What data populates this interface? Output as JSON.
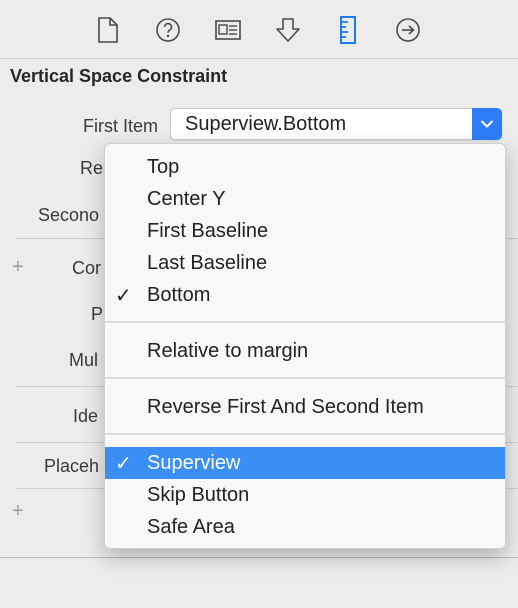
{
  "toolbar": {
    "icons": [
      "file-icon",
      "help-icon",
      "identity-icon",
      "attributes-icon",
      "size-ruler-icon",
      "connections-arrow-icon"
    ],
    "active_index": 4,
    "accent": "#1a7cf5"
  },
  "inspector": {
    "title": "Vertical Space Constraint",
    "rows": {
      "first_item": "First Item",
      "relation": "Re",
      "second_item": "Secono",
      "constant": "Cor",
      "priority": "P",
      "multiplier": "Mul",
      "identifier": "Ide",
      "placeholder": "Placeh"
    },
    "first_item_value": "Superview.Bottom",
    "plus_glyph": "+"
  },
  "menu": {
    "check_glyph": "✓",
    "attributes": [
      {
        "label": "Top",
        "checked": false
      },
      {
        "label": "Center Y",
        "checked": false
      },
      {
        "label": "First Baseline",
        "checked": false
      },
      {
        "label": "Last Baseline",
        "checked": false
      },
      {
        "label": "Bottom",
        "checked": true
      }
    ],
    "relative_to_margin": "Relative to margin",
    "reverse": "Reverse First And Second Item",
    "items": [
      {
        "label": "Superview",
        "checked": true,
        "highlighted": true
      },
      {
        "label": "Skip Button",
        "checked": false
      },
      {
        "label": "Safe Area",
        "checked": false
      }
    ],
    "highlight_color": "#3a8ef6"
  }
}
